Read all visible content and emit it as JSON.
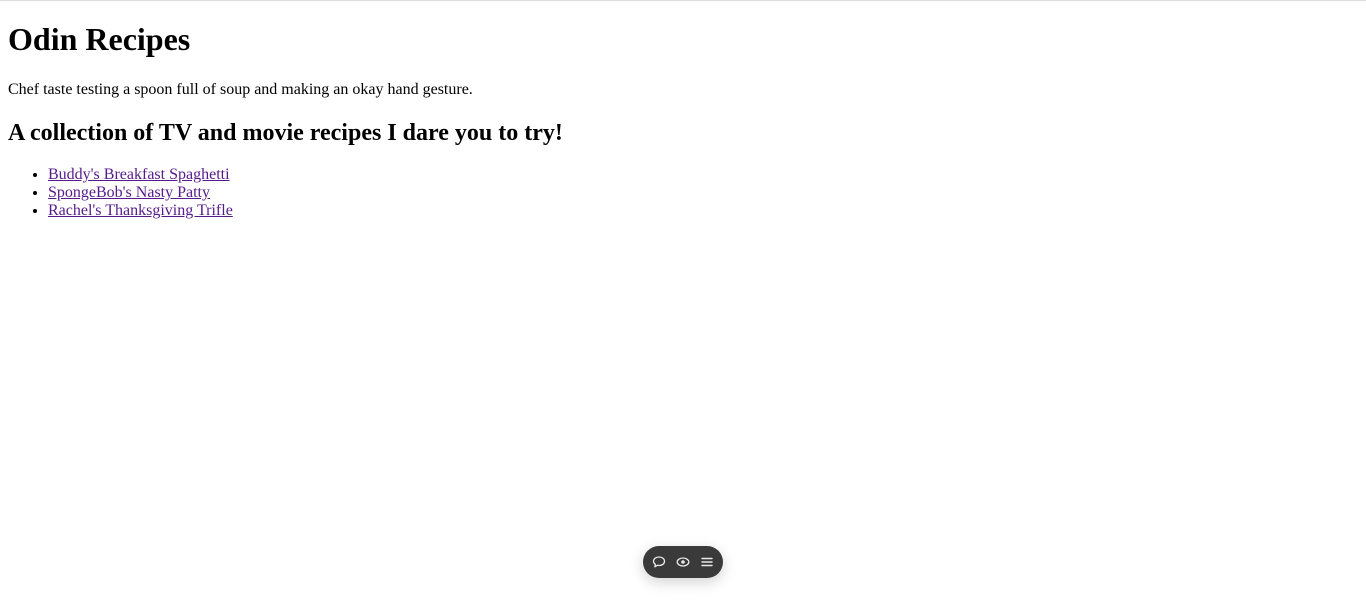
{
  "page": {
    "title": "Odin Recipes",
    "image_alt": "Chef taste testing a spoon full of soup and making an okay hand gesture.",
    "subtitle": "A collection of TV and movie recipes I dare you to try!",
    "recipes": [
      {
        "label": "Buddy's Breakfast Spaghetti"
      },
      {
        "label": "SpongeBob's Nasty Patty"
      },
      {
        "label": "Rachel's Thanksgiving Trifle"
      }
    ]
  },
  "toolbar": {
    "icons": [
      "comment-icon",
      "eye-icon",
      "menu-icon"
    ],
    "background": "#3a3a3a",
    "icon_color": "#e8e8e8"
  },
  "colors": {
    "link_visited": "#551a8b",
    "text": "#000000",
    "background": "#ffffff"
  }
}
